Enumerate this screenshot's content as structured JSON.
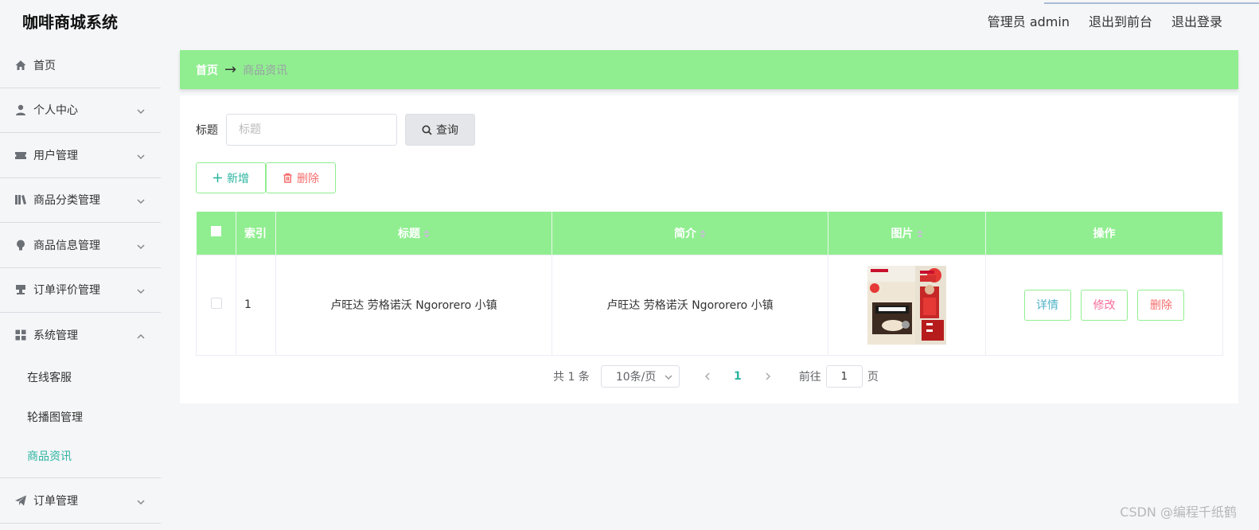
{
  "app": {
    "title": "咖啡商城系统",
    "admin_label": "管理员 admin",
    "to_front_label": "退出到前台",
    "logout_label": "退出登录"
  },
  "sidebar": {
    "items": [
      {
        "label": "首页",
        "icon": "home-icon"
      },
      {
        "label": "个人中心",
        "icon": "user-icon"
      },
      {
        "label": "用户管理",
        "icon": "ticket-icon"
      },
      {
        "label": "商品分类管理",
        "icon": "books-icon"
      },
      {
        "label": "商品信息管理",
        "icon": "bulb-icon"
      },
      {
        "label": "订单评价管理",
        "icon": "stamp-icon"
      },
      {
        "label": "系统管理",
        "icon": "grid-icon"
      },
      {
        "label": "订单管理",
        "icon": "send-icon"
      }
    ],
    "sub_items": [
      {
        "label": "在线客服"
      },
      {
        "label": "轮播图管理"
      },
      {
        "label": "商品资讯",
        "active": true
      }
    ]
  },
  "breadcrumb": {
    "home": "首页",
    "arrow": "→",
    "current": "商品资讯"
  },
  "search": {
    "label": "标题",
    "placeholder": "标题",
    "value": "",
    "button_label": "查询"
  },
  "actions": {
    "add_label": "新增",
    "delete_label": "删除"
  },
  "table": {
    "columns": [
      "索引",
      "标题",
      "简介",
      "图片",
      "操作"
    ],
    "rows": [
      {
        "index": "1",
        "title": "卢旺达 劳格诺沃 Ngororero 小镇",
        "intro": "卢旺达 劳格诺沃 Ngororero 小镇",
        "image": "coffee-product-image"
      }
    ],
    "row_actions": {
      "detail": "详情",
      "edit": "修改",
      "delete": "删除"
    }
  },
  "pagination": {
    "total_text": "共 1 条",
    "page_size": "10条/页",
    "current_page": "1",
    "goto_prefix": "前往",
    "goto_value": "1",
    "goto_suffix": "页"
  },
  "watermark": "CSDN @编程千纸鹤",
  "colors": {
    "accent_green": "#90ee90",
    "teal": "#2bb4a0",
    "danger": "#f56c6c"
  }
}
